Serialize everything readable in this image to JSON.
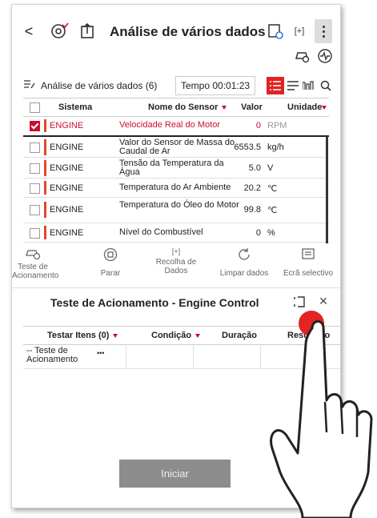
{
  "header": {
    "back_label": "<",
    "title": "Análise de vários dados",
    "right_icon_label": "[+]"
  },
  "toolbar": {
    "list_title": "Análise de vários dados (6)",
    "time_label": "Tempo",
    "time_value": "00:01:23"
  },
  "grid": {
    "columns": [
      "Sistema",
      "Nome do Sensor",
      "Valor",
      "Unidade"
    ],
    "rows": [
      {
        "system": "ENGINE",
        "sensor": "Velocidade Real do Motor",
        "value": "0",
        "unit": "RPM",
        "checked": true
      },
      {
        "system": "ENGINE",
        "sensor": "Valor do Sensor de Massa do Caudal de Ar",
        "value": "6553.5",
        "unit": "kg/h",
        "checked": false
      },
      {
        "system": "ENGINE",
        "sensor": "Tensão da Temperatura da Água",
        "value": "5.0",
        "unit": "V",
        "checked": false
      },
      {
        "system": "ENGINE",
        "sensor": "Temperatura do Ar Ambiente",
        "value": "20.2",
        "unit": "℃",
        "checked": false
      },
      {
        "system": "ENGINE",
        "sensor": "Temperatura do Óleo do Motor",
        "value": "99.8",
        "unit": "℃",
        "checked": false
      },
      {
        "system": "ENGINE",
        "sensor": "Nível do Combustível",
        "value": "0",
        "unit": "%",
        "checked": false
      }
    ]
  },
  "actions": {
    "teste": "Teste de Acionamento",
    "parar": "Parar",
    "recolha": "Recolha de Dados",
    "limpar": "Limpar dados",
    "ecra": "Ecrã selectivo"
  },
  "panel": {
    "title": "Teste de Acionamento  - Engine Control",
    "close_label": "×",
    "columns": [
      "Testar Itens (0)",
      "Condição",
      "Duração",
      "Resultado"
    ],
    "row_item": "-- Teste de Acionamento",
    "row_more": "•••",
    "start_button": "Iniciar"
  },
  "colors": {
    "accent_red": "#c8102e",
    "button_gray": "#8c8c8c"
  }
}
